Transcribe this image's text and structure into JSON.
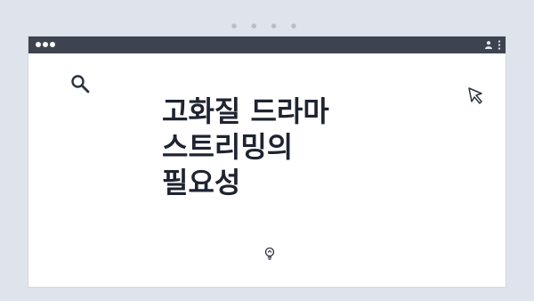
{
  "window": {
    "top_dots": "● ● ● ●"
  },
  "article": {
    "title_lines": [
      "고화질 드라마",
      "스트리밍의",
      "필요성"
    ]
  },
  "icons": {
    "search": "search-icon",
    "cursor": "cursor-icon",
    "lightbulb": "lightbulb-icon",
    "profile": "profile-icon",
    "menu": "menu-icon"
  },
  "colors": {
    "background": "#dfe3ec",
    "titlebar": "#3d4450",
    "content": "#ffffff",
    "title_text": "#1e2430"
  }
}
